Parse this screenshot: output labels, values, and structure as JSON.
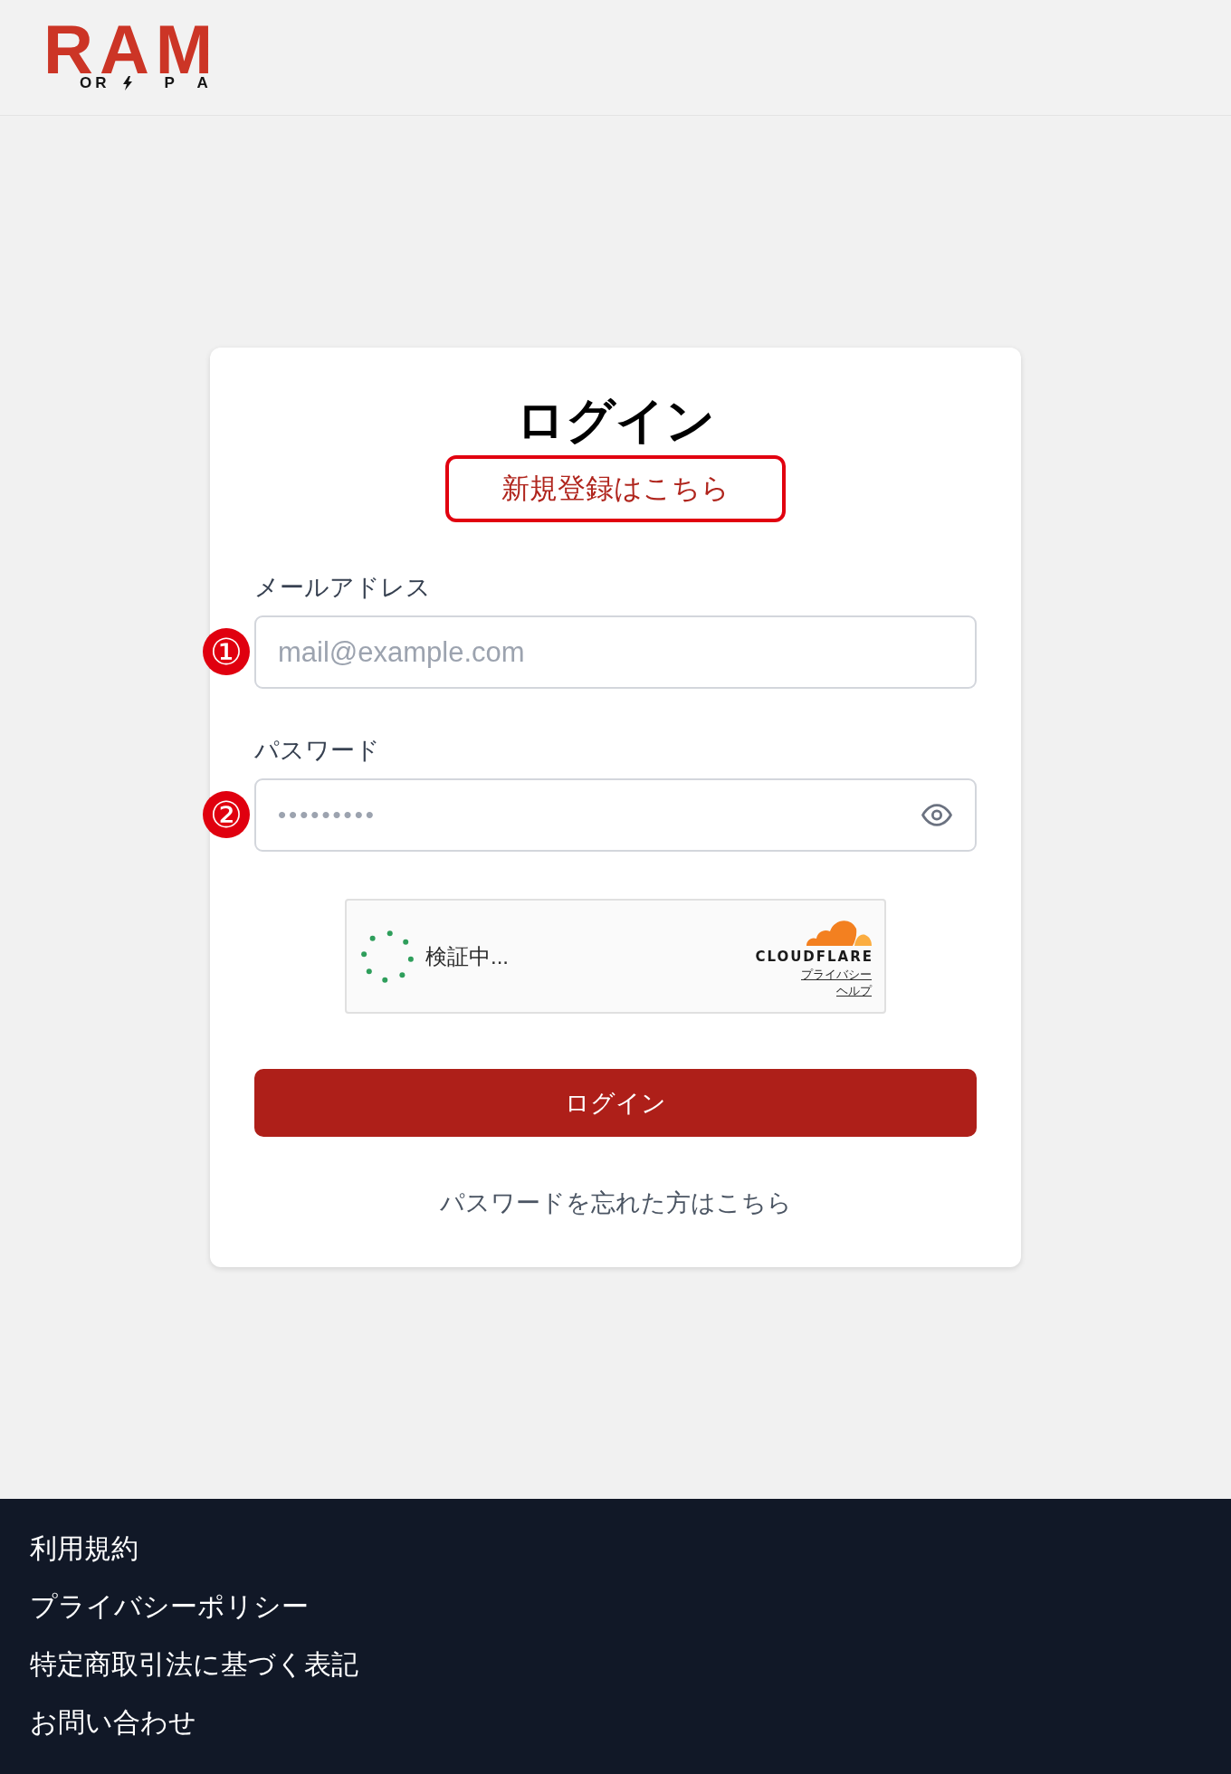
{
  "header": {
    "logo": {
      "wordmark": "RAM",
      "tagline_parts": [
        "OR",
        "PA"
      ]
    }
  },
  "login_card": {
    "title": "ログイン",
    "register_link": "新規登録はこちら",
    "fields": [
      {
        "kind": "email",
        "label": "メールアドレス",
        "marker": "①",
        "placeholder": "mail@example.com"
      },
      {
        "kind": "password",
        "label": "パスワード",
        "marker": "②",
        "placeholder": "•••••••••"
      }
    ],
    "captcha": {
      "status": "検証中...",
      "brand": "CLOUDFLARE",
      "links": [
        "プライバシー",
        "ヘルプ"
      ]
    },
    "submit_button": "ログイン",
    "forgot_password_link": "パスワードを忘れた方はこちら"
  },
  "footer": {
    "links": [
      "利用規約",
      "プライバシーポリシー",
      "特定商取引法に基づく表記",
      "お問い合わせ"
    ]
  }
}
